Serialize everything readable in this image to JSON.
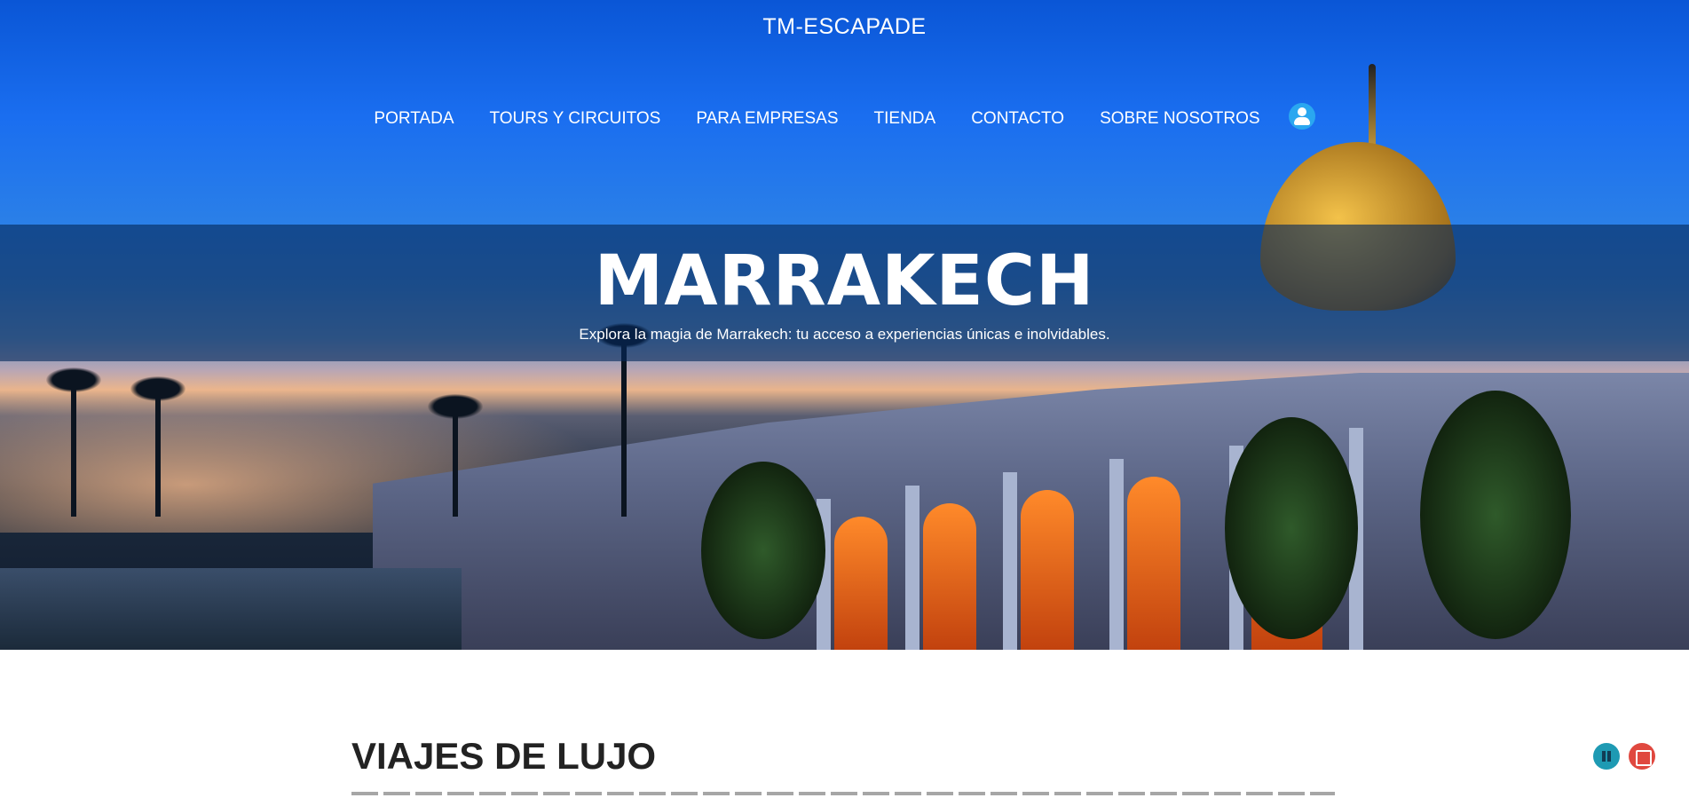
{
  "site": {
    "title": "TM-ESCAPADE"
  },
  "nav": {
    "items": [
      {
        "label": "PORTADA"
      },
      {
        "label": "TOURS Y CIRCUITOS"
      },
      {
        "label": "PARA EMPRESAS"
      },
      {
        "label": "TIENDA"
      },
      {
        "label": "CONTACTO"
      },
      {
        "label": "SOBRE NOSOTROS"
      }
    ],
    "account_icon": "user-icon"
  },
  "hero": {
    "title": "MARRAKECH",
    "subtitle": "Explora la magia de Marrakech: tu acceso a experiencias únicas e inolvidables."
  },
  "content": {
    "section_title": "VIAJES DE LUJO"
  },
  "media_controls": {
    "pause_icon": "pause-icon",
    "stop_icon": "stop-icon"
  },
  "colors": {
    "banner_overlay": "#05285a",
    "pause": "#1e9ab3",
    "stop": "#e0483f"
  }
}
